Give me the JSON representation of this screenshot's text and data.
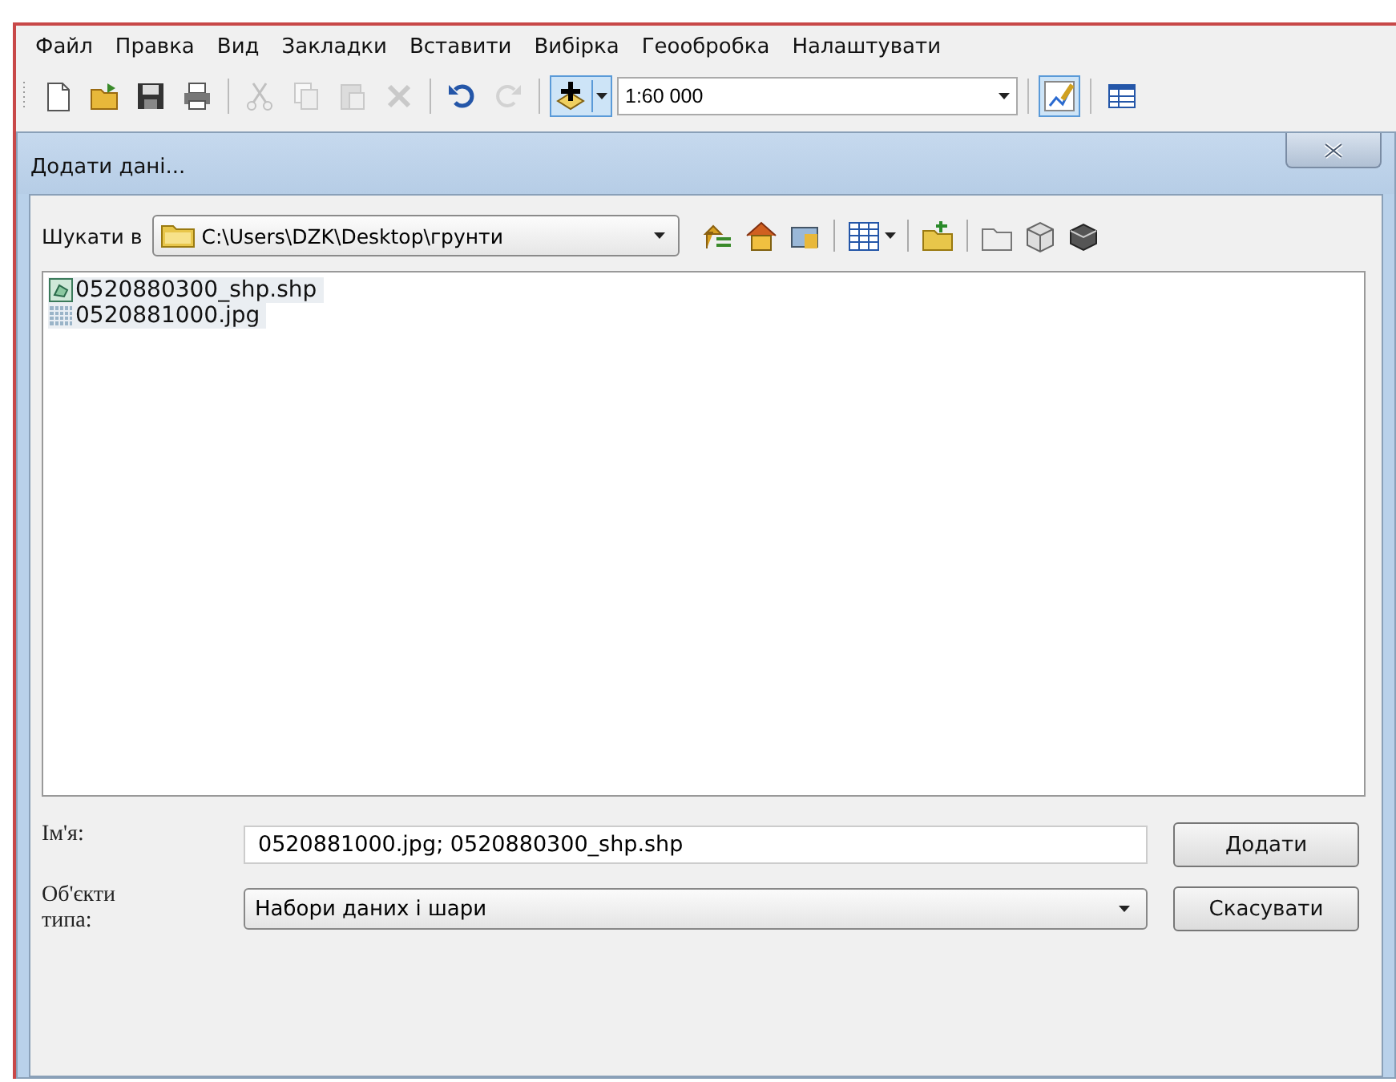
{
  "menu": [
    "Файл",
    "Правка",
    "Вид",
    "Закладки",
    "Вставити",
    "Вибірка",
    "Геообробка",
    "Налаштувати"
  ],
  "toolbar": [
    {
      "kind": "new",
      "disabled": false
    },
    {
      "kind": "open",
      "disabled": false
    },
    {
      "kind": "save",
      "disabled": false
    },
    {
      "kind": "print",
      "disabled": false
    },
    {
      "kind": "sep"
    },
    {
      "kind": "cut",
      "disabled": true
    },
    {
      "kind": "copy",
      "disabled": true
    },
    {
      "kind": "paste",
      "disabled": true
    },
    {
      "kind": "delete",
      "disabled": true
    },
    {
      "kind": "sep"
    },
    {
      "kind": "undo",
      "disabled": false
    },
    {
      "kind": "redo",
      "disabled": true
    },
    {
      "kind": "sep"
    },
    {
      "kind": "add",
      "disabled": false,
      "selected": true
    },
    {
      "kind": "scale",
      "value": "1:60 000"
    },
    {
      "kind": "sep"
    },
    {
      "kind": "editor",
      "disabled": false,
      "selected": true
    },
    {
      "kind": "sep"
    },
    {
      "kind": "table",
      "disabled": false
    }
  ],
  "dialog": {
    "title": "Додати дані...",
    "look_in": {
      "label": "Шукати в",
      "value": "C:\\Users\\DZK\\Desktop\\грунти"
    },
    "files": [
      {
        "name": "0520880300_shp.shp",
        "kind": "shape",
        "selected": true
      },
      {
        "name": "0520881000.jpg",
        "kind": "raster",
        "selected": true
      }
    ],
    "name_field": {
      "label": "Ім'я:",
      "value": "0520881000.jpg; 0520880300_shp.shp"
    },
    "type_field": {
      "label": "Об'єкти типа:",
      "value": "Набори даних і шари"
    },
    "buttons": [
      "Додати",
      "Скасувати"
    ]
  }
}
